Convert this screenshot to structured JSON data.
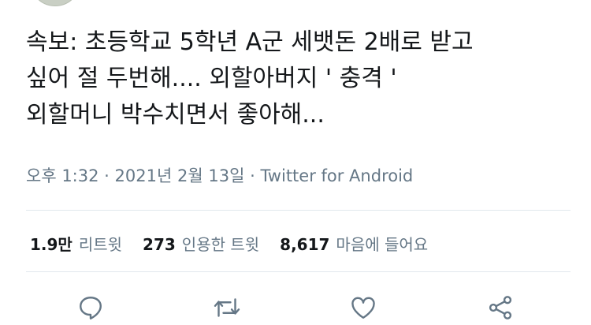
{
  "tweet": {
    "text_lines": [
      "속보: 초등학교 5학년 A군 세뱃돈 2배로 받고",
      "싶어 절 두번해.... 외할아버지 ' 충격 '",
      "외할머니 박수치면서 좋아해..."
    ],
    "time": "오후 1:32",
    "separator": "·",
    "date": "2021년 2월 13일",
    "source": "Twitter for Android"
  },
  "stats": [
    {
      "count": "1.9만",
      "label": "리트윗"
    },
    {
      "count": "273",
      "label": "인용한 트윗"
    },
    {
      "count": "8,617",
      "label": "마음에 들어요"
    }
  ],
  "actions": {
    "reply_icon": "reply-icon",
    "retweet_icon": "retweet-icon",
    "like_icon": "heart-icon",
    "share_icon": "share-icon",
    "icon_color": "#657786"
  }
}
